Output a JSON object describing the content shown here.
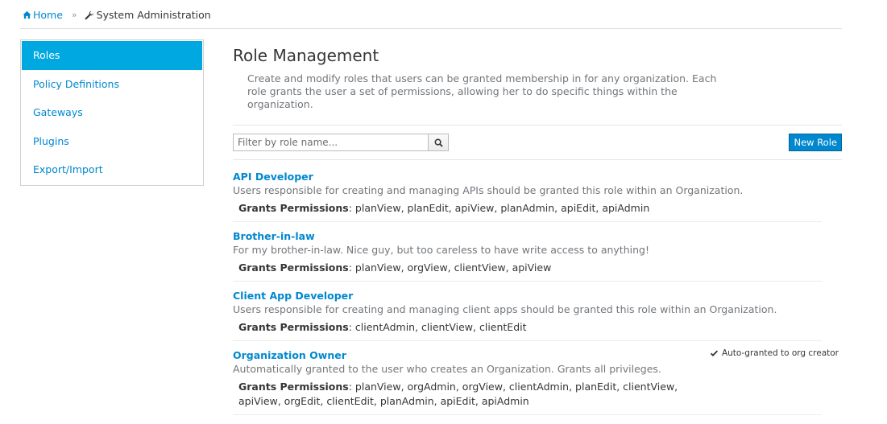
{
  "breadcrumb": {
    "home_label": "Home",
    "separator": "»",
    "current_label": "System Administration",
    "home_icon": "home-icon",
    "current_icon": "wrench-icon"
  },
  "sidebar": {
    "items": [
      {
        "label": "Roles",
        "active": true
      },
      {
        "label": "Policy Definitions",
        "active": false
      },
      {
        "label": "Gateways",
        "active": false
      },
      {
        "label": "Plugins",
        "active": false
      },
      {
        "label": "Export/Import",
        "active": false
      }
    ]
  },
  "main": {
    "title": "Role Management",
    "description": "Create and modify roles that users can be granted membership in for any organization. Each role grants the user a set of permissions, allowing her to do specific things within the organization.",
    "filter": {
      "placeholder": "Filter by role name...",
      "value": ""
    },
    "search_icon": "search-icon",
    "new_role_label": "New Role",
    "roles": [
      {
        "name": "API Developer",
        "description": "Users responsible for creating and managing APIs should be granted this role within an Organization.",
        "perm_label": "Grants Permissions",
        "perms": ": planView, planEdit, apiView, planAdmin, apiEdit, apiAdmin",
        "auto_granted": ""
      },
      {
        "name": "Brother-in-law",
        "description": "For my brother-in-law. Nice guy, but too careless to have write access to anything!",
        "perm_label": "Grants Permissions",
        "perms": ": planView, orgView, clientView, apiView",
        "auto_granted": ""
      },
      {
        "name": "Client App Developer",
        "description": "Users responsible for creating and managing client apps should be granted this role within an Organization.",
        "perm_label": "Grants Permissions",
        "perms": ": clientAdmin, clientView, clientEdit",
        "auto_granted": ""
      },
      {
        "name": "Organization Owner",
        "description": "Automatically granted to the user who creates an Organization. Grants all privileges.",
        "perm_label": "Grants Permissions",
        "perms": ": planView, orgAdmin, orgView, clientAdmin, planEdit, clientView, apiView, orgEdit, clientEdit, planAdmin, apiEdit, apiAdmin",
        "auto_granted": "Auto-granted to org creator"
      }
    ]
  },
  "colors": {
    "link": "#0088ce",
    "active_bg": "#00a8e1",
    "button_bg": "#0088ce",
    "muted_text": "#72767b"
  }
}
